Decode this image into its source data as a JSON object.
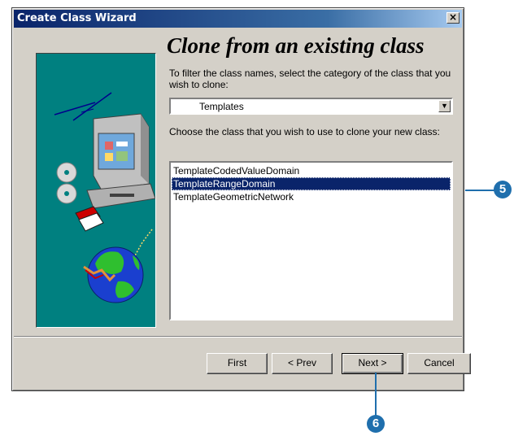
{
  "window": {
    "title": "Create Class Wizard",
    "close_glyph": "×"
  },
  "page": {
    "heading": "Clone from an existing class",
    "filter_instruction": "To filter the class names, select the category of the class that you wish to clone:",
    "category_selected": "Templates",
    "choose_instruction": "Choose the class that you wish to use to clone your new class:",
    "classes": [
      {
        "name": "TemplateCodedValueDomain",
        "selected": false
      },
      {
        "name": "TemplateRangeDomain",
        "selected": true
      },
      {
        "name": "TemplateGeometricNetwork",
        "selected": false
      }
    ]
  },
  "buttons": {
    "first": "First",
    "prev": "< Prev",
    "next": "Next >",
    "cancel": "Cancel"
  },
  "callouts": {
    "list_step": "5",
    "next_step": "6",
    "color": "#1f6fad"
  },
  "colors": {
    "titlebar": "#0a246a",
    "dialog_bg": "#d4d0c8",
    "art_bg": "#008080",
    "selection": "#0a246a"
  },
  "icons": [
    "computer-icon",
    "cd-disc-icon",
    "globe-icon"
  ]
}
